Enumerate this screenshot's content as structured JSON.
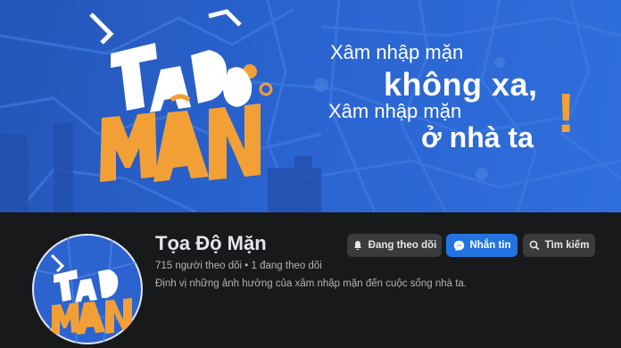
{
  "cover": {
    "logo_text_top": "TỌA ĐỘ",
    "logo_text_bottom": "MẶN",
    "slogan_line1": "Xâm nhập mặn",
    "slogan_line2": "không xa,",
    "slogan_line3": "Xâm nhập mặn",
    "slogan_line4": "ở nhà ta",
    "slogan_mark": "!"
  },
  "profile": {
    "name": "Tọa Độ Mặn",
    "stats": "715 người theo dõi • 1 đang theo dõi",
    "bio": "Định vị những ảnh hưởng của xâm nhập mặn đến cuộc sống nhà ta."
  },
  "actions": {
    "following_label": "Đang theo dõi",
    "message_label": "Nhắn tin",
    "search_label": "Tìm kiếm"
  },
  "icons": {
    "following": "bell-icon",
    "message": "messenger-icon",
    "search": "search-icon"
  },
  "colors": {
    "cover_blue": "#2a63cf",
    "accent_orange": "#f2a035",
    "message_button": "#2374e1",
    "background": "#18191a"
  }
}
